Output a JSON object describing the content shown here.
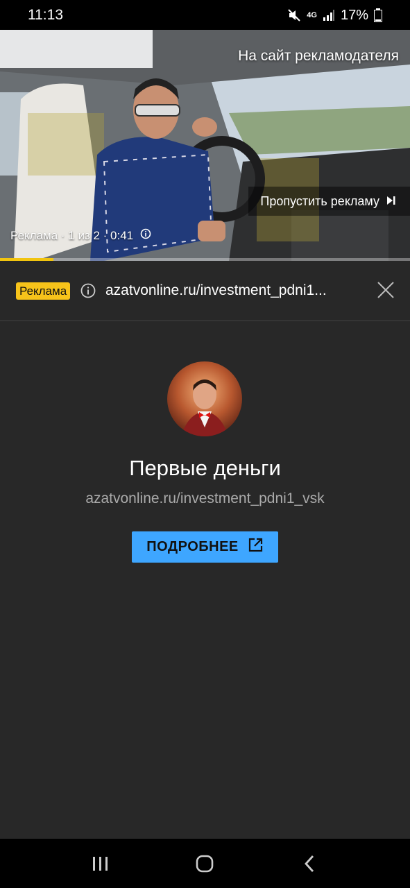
{
  "status_bar": {
    "time": "11:13",
    "network": "4G",
    "battery": "17%"
  },
  "video": {
    "advertiser_link": "На сайт рекламодателя",
    "skip_label": "Пропустить рекламу",
    "ad_info": "Реклама · 1 из 2 · 0:41",
    "progress_fraction": 0.13
  },
  "ad_header": {
    "badge": "Реклама",
    "url": "azatvonline.ru/investment_pdni1..."
  },
  "card": {
    "title": "Первые деньги",
    "url": "azatvonline.ru/investment_pdni1_vsk",
    "cta_label": "ПОДРОБНЕЕ"
  },
  "colors": {
    "accent": "#3ea6ff",
    "badge": "#f7c31a",
    "progress": "#f1c40f",
    "background": "#282828"
  }
}
